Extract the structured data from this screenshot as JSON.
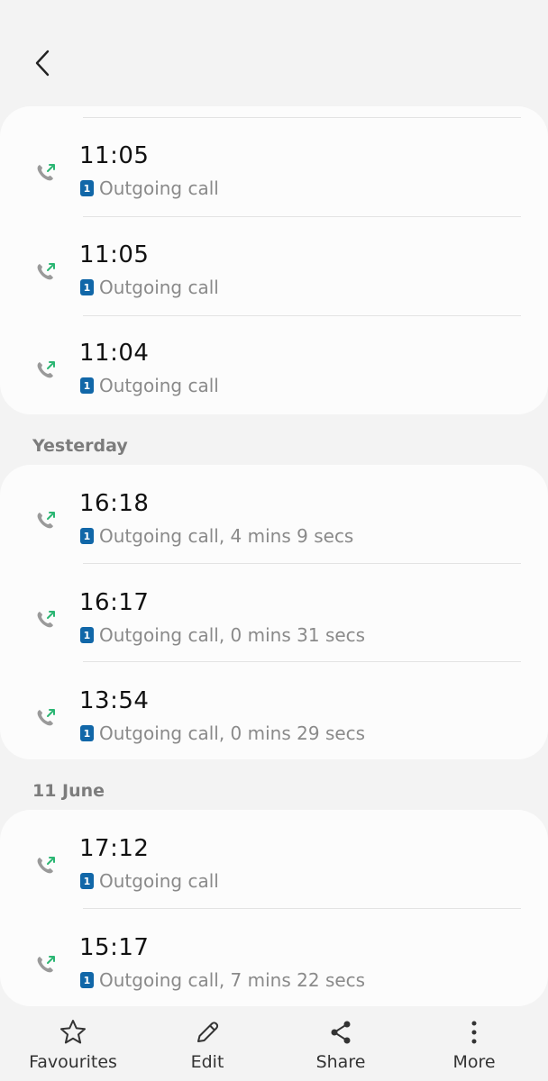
{
  "icons": {
    "back": "chevron-left-icon",
    "outgoing_call": "outgoing-call-icon",
    "sim": "sim-1-icon"
  },
  "colors": {
    "sim_badge": "#1167a8",
    "outgoing_arrow": "#2bb673",
    "phone_handset": "#9a9a9a"
  },
  "groups": [
    {
      "header": "",
      "calls": [
        {
          "time": "11:05",
          "sim": "1",
          "detail": "Outgoing call"
        },
        {
          "time": "11:05",
          "sim": "1",
          "detail": "Outgoing call"
        },
        {
          "time": "11:04",
          "sim": "1",
          "detail": "Outgoing call"
        }
      ]
    },
    {
      "header": "Yesterday",
      "calls": [
        {
          "time": "16:18",
          "sim": "1",
          "detail": "Outgoing call, 4 mins 9 secs"
        },
        {
          "time": "16:17",
          "sim": "1",
          "detail": "Outgoing call, 0 mins 31 secs"
        },
        {
          "time": "13:54",
          "sim": "1",
          "detail": "Outgoing call, 0 mins 29 secs"
        }
      ]
    },
    {
      "header": "11 June",
      "calls": [
        {
          "time": "17:12",
          "sim": "1",
          "detail": "Outgoing call"
        },
        {
          "time": "15:17",
          "sim": "1",
          "detail": "Outgoing call, 7 mins 22 secs"
        }
      ]
    }
  ],
  "bottom_bar": {
    "favourites": {
      "label": "Favourites",
      "icon": "star-icon"
    },
    "edit": {
      "label": "Edit",
      "icon": "pencil-icon"
    },
    "share": {
      "label": "Share",
      "icon": "share-icon"
    },
    "more": {
      "label": "More",
      "icon": "more-vertical-icon"
    }
  }
}
